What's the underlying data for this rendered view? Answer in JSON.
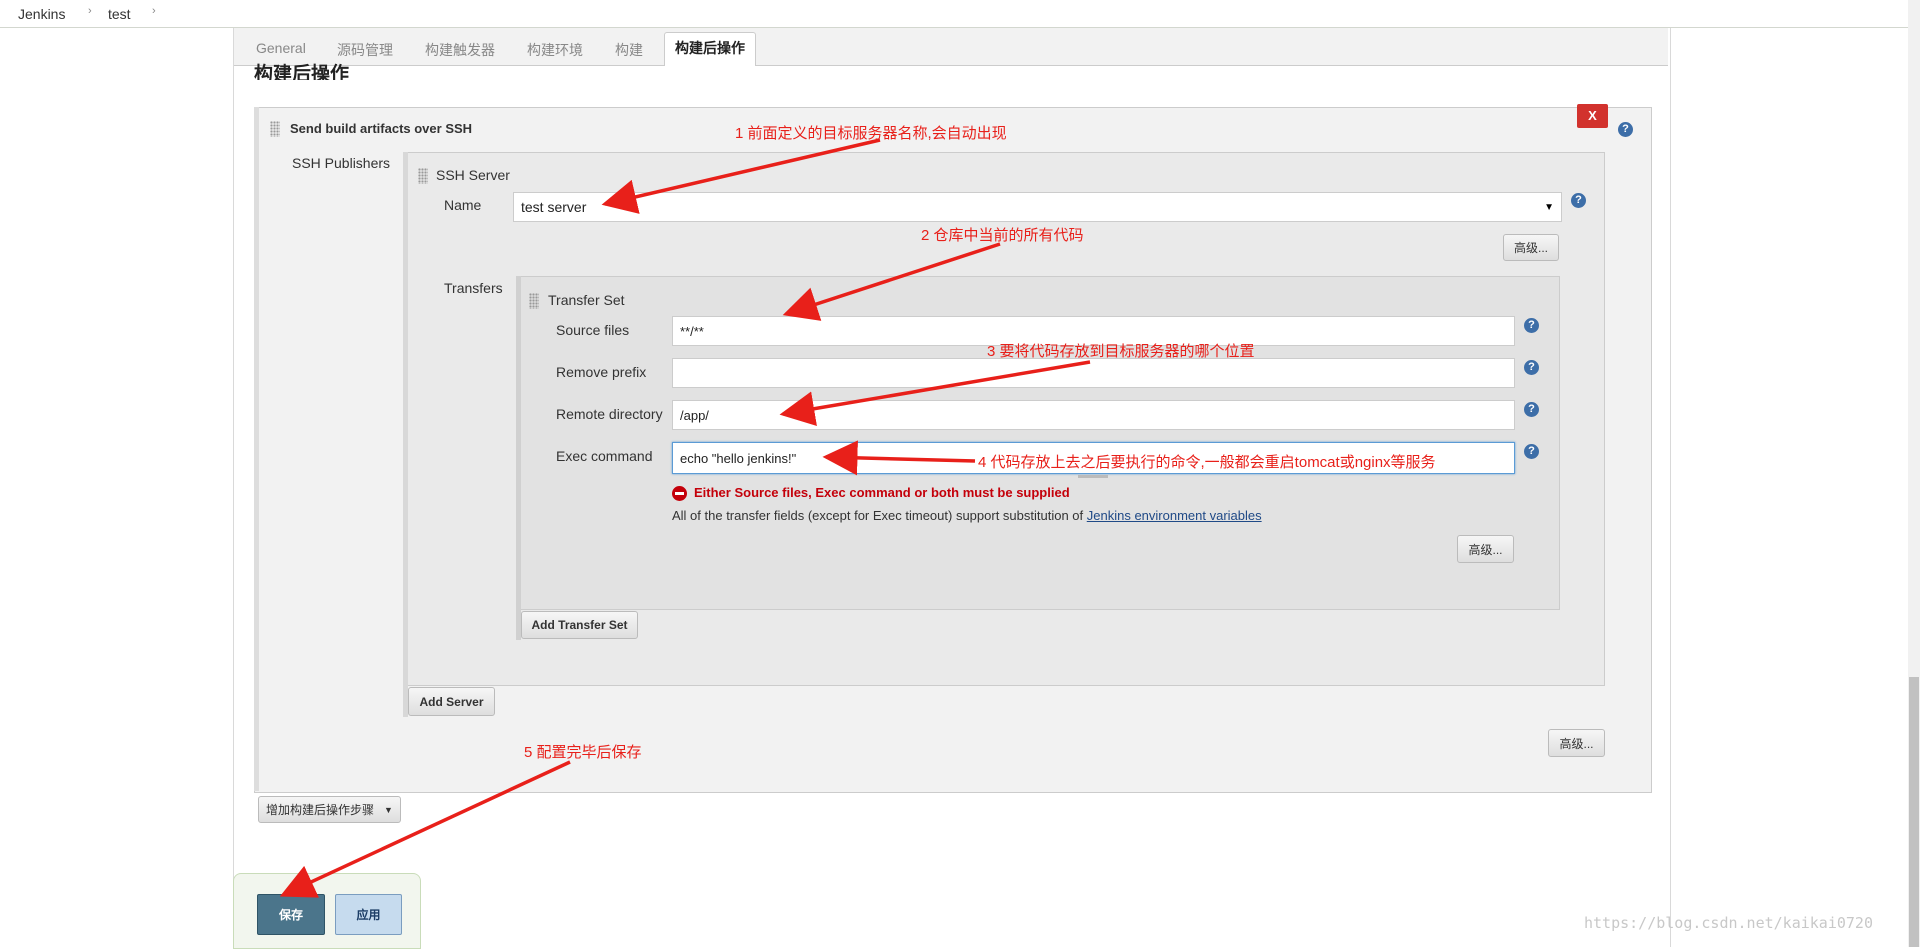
{
  "breadcrumb": {
    "items": [
      "Jenkins",
      "test"
    ],
    "separator": "›"
  },
  "tabs": [
    {
      "label": "General",
      "active": false
    },
    {
      "label": "源码管理",
      "active": false
    },
    {
      "label": "构建触发器",
      "active": false
    },
    {
      "label": "构建环境",
      "active": false
    },
    {
      "label": "构建",
      "active": false
    },
    {
      "label": "构建后操作",
      "active": true
    }
  ],
  "section_title": "构建后操作",
  "publisher": {
    "title": "Send build artifacts over SSH",
    "delete_label": "X",
    "ssh_publishers_label": "SSH Publishers",
    "ssh_server": {
      "title": "SSH Server",
      "name_label": "Name",
      "name_value": "test server",
      "advanced_label": "高级...",
      "transfers_label": "Transfers"
    },
    "transfer_set": {
      "title": "Transfer Set",
      "source_files_label": "Source files",
      "source_files_value": "**/**",
      "remove_prefix_label": "Remove prefix",
      "remove_prefix_value": "",
      "remote_directory_label": "Remote directory",
      "remote_directory_value": "/app/",
      "exec_command_label": "Exec command",
      "exec_command_value": "echo \"hello jenkins!\"",
      "error_text": "Either Source files, Exec command or both must be supplied",
      "substitution_text": "All of the transfer fields (except for Exec timeout) support substitution of ",
      "substitution_link": "Jenkins environment variables",
      "advanced_label": "高级..."
    },
    "add_transfer_set_label": "Add Transfer Set",
    "add_server_label": "Add Server",
    "advanced_label": "高级..."
  },
  "add_step_label": "增加构建后操作步骤",
  "save_label": "保存",
  "apply_label": "应用",
  "help_glyph": "?",
  "annotations": [
    "1 前面定义的目标服务器名称,会自动出现",
    "2 仓库中当前的所有代码",
    "3 要将代码存放到目标服务器的哪个位置",
    "4 代码存放上去之后要执行的命令,一般都会重启tomcat或nginx等服务",
    "5 配置完毕后保存"
  ],
  "watermark": "https://blog.csdn.net/kaikai0720",
  "colors": {
    "annotation": "#e8201a",
    "error": "#c4000a",
    "save": "#4b758b",
    "help": "#3d6ea8",
    "delete": "#d2322d"
  }
}
